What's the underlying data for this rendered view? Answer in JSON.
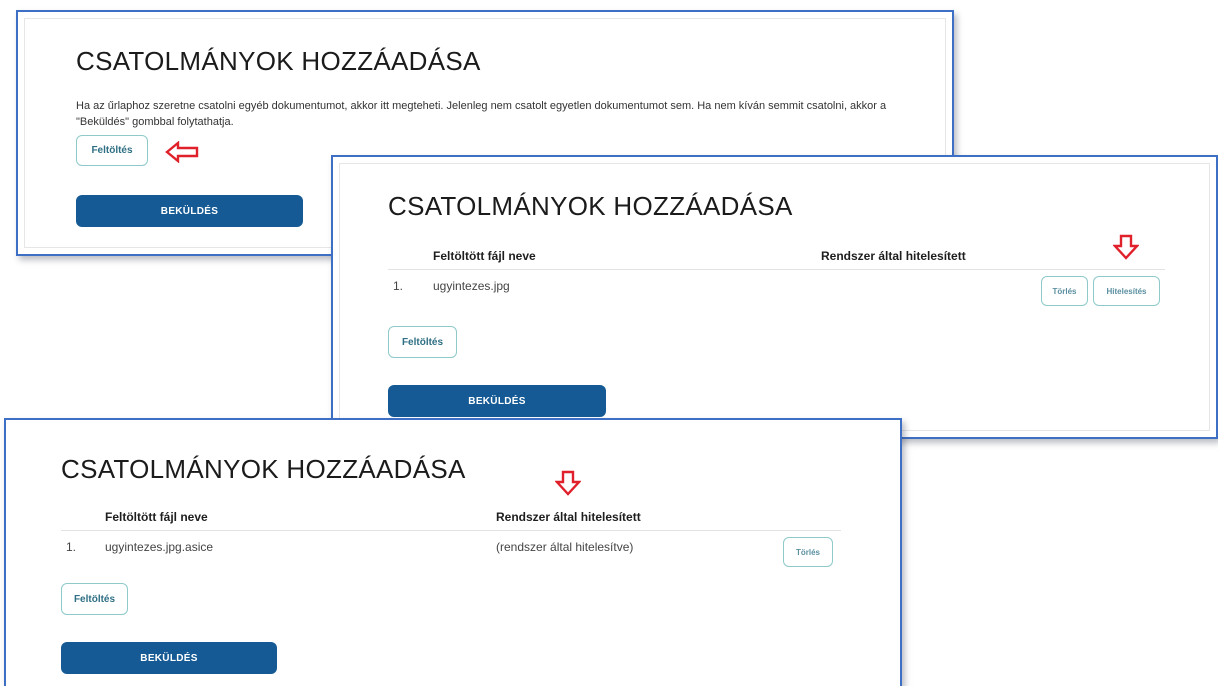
{
  "title": "CSATOLMÁNYOK HOZZÁADÁSA",
  "description": "Ha az űrlaphoz szeretne csatolni egyéb dokumentumot, akkor itt megteheti. Jelenleg nem csatolt egyetlen dokumentumot sem. Ha nem kíván semmit csatolni, akkor a \"Beküldés\" gombbal folytathatja.",
  "buttons": {
    "upload": "Feltöltés",
    "submit": "BEKÜLDÉS",
    "delete": "Törlés",
    "authenticate": "Hitelesítés"
  },
  "table": {
    "col_filename": "Feltöltött fájl neve",
    "col_authenticated": "Rendszer által hitelesített"
  },
  "panel2_rows": [
    {
      "index": "1.",
      "filename": "ugyintezes.jpg",
      "status": ""
    }
  ],
  "panel3_rows": [
    {
      "index": "1.",
      "filename": "ugyintezes.jpg.asice",
      "status": "(rendszer által hitelesítve)"
    }
  ],
  "colors": {
    "panel_border": "#3d6fc4",
    "submit_bg": "#155a94",
    "arrow": "#e0202a",
    "button_border": "#8fc9c9"
  },
  "icons": {
    "left_arrow": "arrow-left-icon",
    "down_arrow": "arrow-down-icon"
  }
}
